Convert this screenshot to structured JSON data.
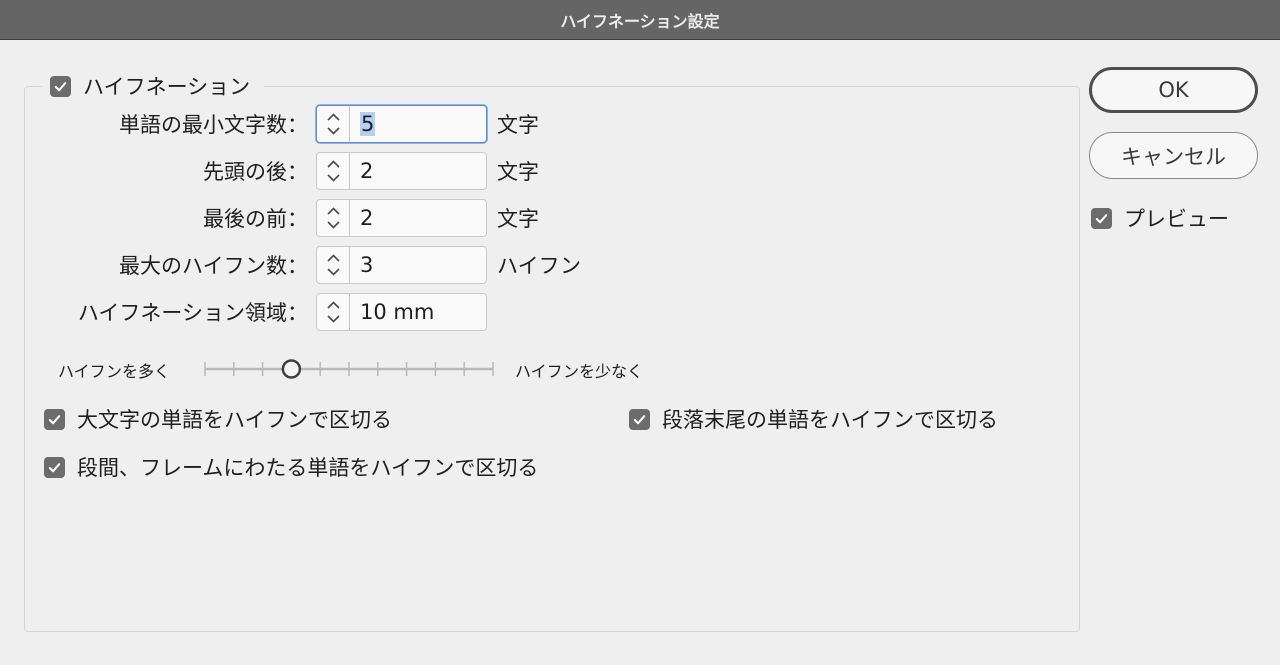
{
  "window": {
    "title": "ハイフネーション設定"
  },
  "group": {
    "label": "ハイフネーション",
    "checked": true
  },
  "fields": [
    {
      "label": "単語の最小文字数：",
      "value": "5",
      "unit": "文字"
    },
    {
      "label": "先頭の後：",
      "value": "2",
      "unit": "文字"
    },
    {
      "label": "最後の前：",
      "value": "2",
      "unit": "文字"
    },
    {
      "label": "最大のハイフン数：",
      "value": "3",
      "unit": "ハイフン"
    },
    {
      "label": "ハイフネーション領域：",
      "value": "10 mm",
      "unit": ""
    }
  ],
  "slider": {
    "left_label": "ハイフンを多く",
    "right_label": "ハイフンを少なく",
    "tick_count": 11,
    "selected_tick_index": 3
  },
  "options": {
    "capitalized": {
      "label": "大文字の単語をハイフンで区切る",
      "checked": true
    },
    "last_word": {
      "label": "段落末尾の単語をハイフンで区切る",
      "checked": true
    },
    "across_columns": {
      "label": "段間、フレームにわたる単語をハイフンで区切る",
      "checked": true
    }
  },
  "buttons": {
    "ok": "OK",
    "cancel": "キャンセル"
  },
  "preview": {
    "label": "プレビュー",
    "checked": true
  },
  "colors": {
    "checkbox": "#6c6c6c",
    "focus": "#5e8ed6",
    "titlebar": "#656565"
  }
}
